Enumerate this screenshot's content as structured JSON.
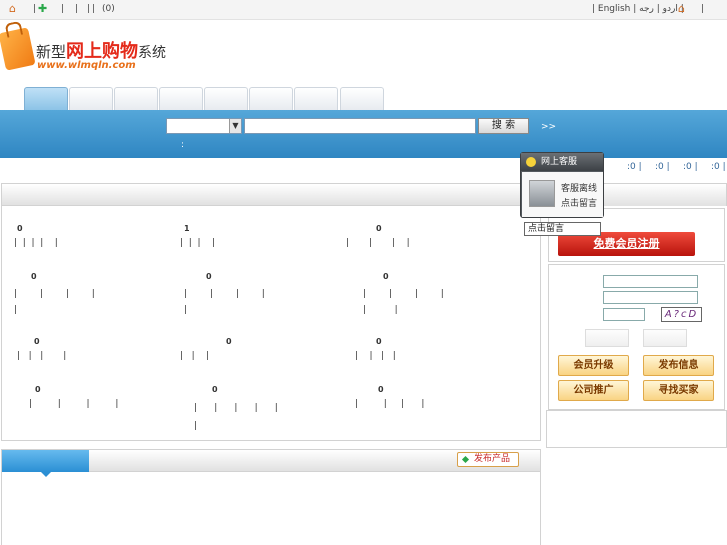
{
  "topbar": {
    "left_sep1": "|",
    "left_sep2": "|",
    "left_sep3": "|",
    "left_sep4": "|",
    "left_sep5": "|",
    "cart_count": "(0)",
    "lang_links": "| English | ﻿ﺍﺭﺩﻭ | ﺭﺟﻪ |"
  },
  "logo": {
    "title_a": "新型",
    "title_b": "网上购物",
    "title_c": "系统",
    "url": "www.wlmqln.com"
  },
  "search": {
    "button_label": "搜 索",
    "advanced": ">>",
    "colon": ":"
  },
  "stats": [
    ":0 |",
    ":0 |",
    ":0 |",
    ":0 |"
  ],
  "customer_service": {
    "header": "网上客服",
    "status": "客服离线",
    "leave_msg": "点击留言",
    "tooltip": "点击留言"
  },
  "categories": [
    {
      "count": "0",
      "links": "|  |  |  |    |"
    },
    {
      "count": "1",
      "links": "|  |  |    |"
    },
    {
      "count": "0",
      "links": "|       |       |    |"
    },
    {
      "count": "0",
      "links": "|        |        |        |\n|"
    },
    {
      "count": "0",
      "links": "|        |        |        |\n|"
    },
    {
      "count": "0",
      "links": "|        |        |        |\n|          |"
    },
    {
      "count": "0",
      "links": "|   |   |       |"
    },
    {
      "count": "0",
      "links": "|   |    |"
    },
    {
      "count": "0",
      "links": "|    |   |   |"
    },
    {
      "count": "0",
      "links": "|         |         |         |"
    },
    {
      "count": "0",
      "links": "|      |      |      |      |\n|"
    },
    {
      "count": "0",
      "links": "|         |     |      |"
    }
  ],
  "sidebar": {
    "register": "免费会员注册",
    "captcha": "A?cD",
    "buttons": [
      "会员升级",
      "发布信息",
      "公司推广",
      "寻找买家"
    ]
  },
  "bottom": {
    "publish": "发布产品"
  }
}
